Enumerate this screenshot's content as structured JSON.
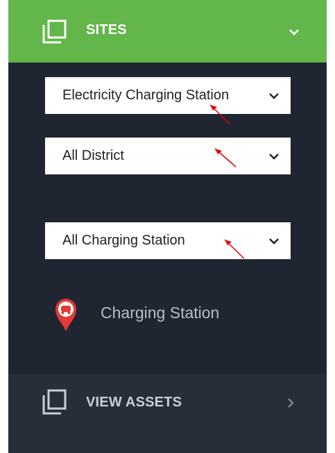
{
  "header": {
    "title": "SITES",
    "icon": "copy-icon",
    "toggle_icon": "chevron-down-icon",
    "color": "#62b64a"
  },
  "filters": [
    {
      "value": "Electricity Charging Station"
    },
    {
      "value": "All District"
    },
    {
      "value": "All Charging Station"
    }
  ],
  "legend": {
    "label": "Charging Station",
    "icon": "charging-station-pin-icon",
    "color": "#e53935"
  },
  "footer": {
    "title": "VIEW ASSETS",
    "icon": "copy-icon",
    "toggle_icon": "chevron-right-icon"
  },
  "annotation_color": "#e00000"
}
